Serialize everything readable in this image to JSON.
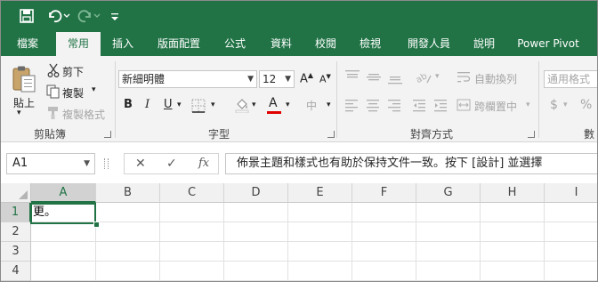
{
  "quick_access": {
    "save_icon": "save-icon",
    "undo_icon": "undo-icon",
    "redo_icon": "redo-icon",
    "customize_icon": "customize-qat-icon"
  },
  "tabs": [
    {
      "label": "檔案",
      "active": false
    },
    {
      "label": "常用",
      "active": true
    },
    {
      "label": "插入",
      "active": false
    },
    {
      "label": "版面配置",
      "active": false
    },
    {
      "label": "公式",
      "active": false
    },
    {
      "label": "資料",
      "active": false
    },
    {
      "label": "校閱",
      "active": false
    },
    {
      "label": "檢視",
      "active": false
    },
    {
      "label": "開發人員",
      "active": false
    },
    {
      "label": "說明",
      "active": false
    },
    {
      "label": "Power Pivot",
      "active": false
    }
  ],
  "clipboard": {
    "paste": "貼上",
    "cut": "剪下",
    "copy": "複製",
    "format_painter": "複製格式",
    "group": "剪貼簿"
  },
  "font": {
    "name": "新細明體",
    "size": "12",
    "bold": "B",
    "italic": "I",
    "underline": "U",
    "grow": "A",
    "shrink": "A",
    "font_color": "A",
    "phonetic": "中",
    "group": "字型"
  },
  "alignment": {
    "wrap_text": "自動換列",
    "merge_center": "跨欄置中",
    "group": "對齊方式"
  },
  "number": {
    "format": "通用格式",
    "currency": "$",
    "percent": "%",
    "group": "數"
  },
  "formula_bar": {
    "name_box": "A1",
    "cancel": "✕",
    "enter": "✓",
    "fx": "fx",
    "content": "佈景主題和樣式也有助於保持文件一致。按下 [設計] 並選擇"
  },
  "sheet": {
    "columns": [
      "A",
      "B",
      "C",
      "D",
      "E",
      "F",
      "G",
      "H",
      "I"
    ],
    "rows": [
      "1",
      "2",
      "3",
      "4"
    ],
    "active_cell": "A1",
    "cells": {
      "A1": "更。"
    }
  },
  "colors": {
    "brand": "#217346",
    "ribbon_bg": "#f3f3f3",
    "font_color_bar": "#e00000"
  }
}
